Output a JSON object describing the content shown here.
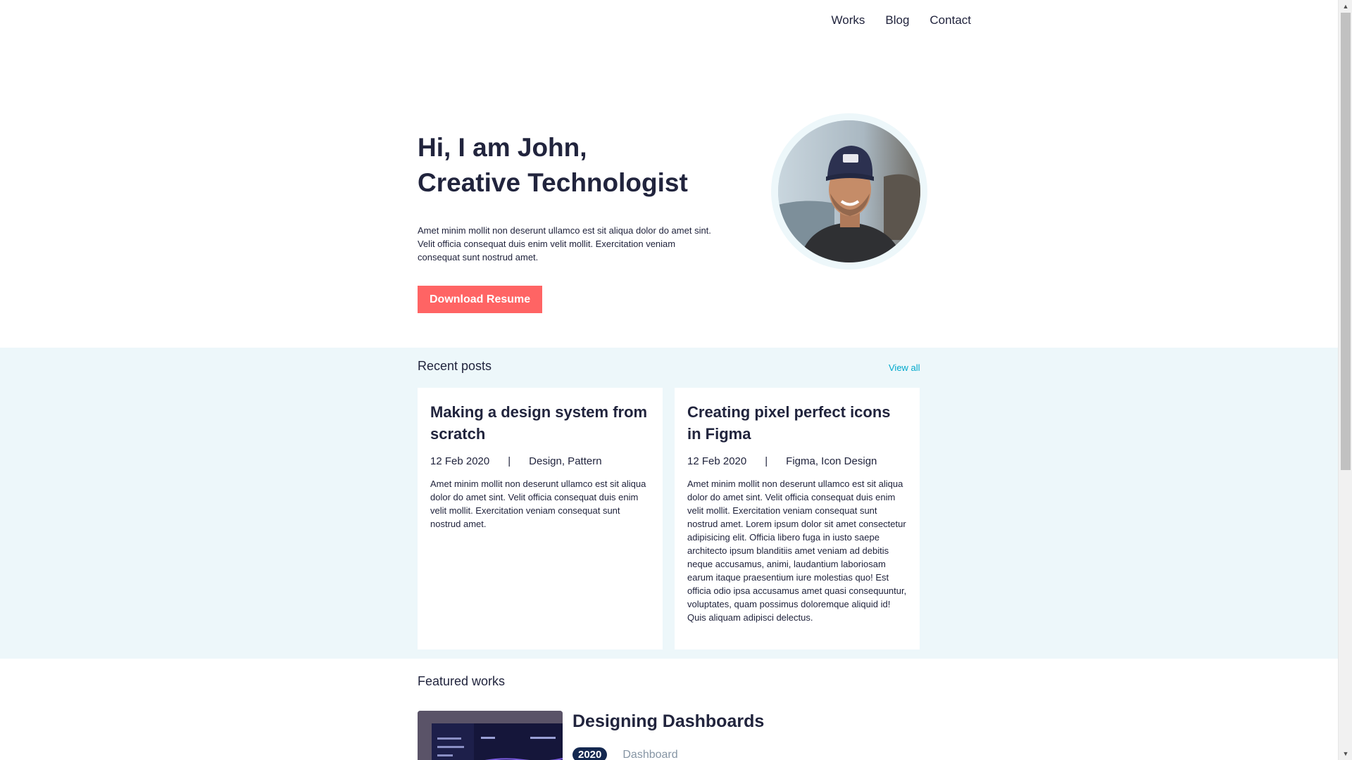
{
  "nav": {
    "items": [
      "Works",
      "Blog",
      "Contact"
    ]
  },
  "hero": {
    "title_line1": "Hi, I am John,",
    "title_line2": "Creative Technologist",
    "description": "Amet minim mollit non deserunt ullamco est sit aliqua dolor do amet sint. Velit officia consequat duis enim velit mollit. Exercitation veniam consequat sunt nostrud amet.",
    "button_label": "Download Resume"
  },
  "recent_posts": {
    "title": "Recent posts",
    "view_all": "View all",
    "posts": [
      {
        "title": "Making a design system from scratch",
        "date": "12 Feb 2020",
        "separator": "|",
        "tags": "Design, Pattern",
        "excerpt": "Amet minim mollit non deserunt ullamco est sit aliqua dolor do amet sint. Velit officia consequat duis enim velit mollit. Exercitation veniam consequat sunt nostrud amet."
      },
      {
        "title": "Creating pixel perfect icons in Figma",
        "date": "12 Feb 2020",
        "separator": "|",
        "tags": "Figma, Icon Design",
        "excerpt": "Amet minim mollit non deserunt ullamco est sit aliqua dolor do amet sint. Velit officia consequat duis enim velit mollit. Exercitation veniam consequat sunt nostrud amet. Lorem ipsum dolor sit amet consectetur adipisicing elit. Officia libero fuga in iusto saepe architecto ipsum blanditiis amet veniam ad debitis neque accusamus, animi, laudantium laboriosam earum itaque praesentium iure molestias quo! Est officia odio ipsa accusamus amet quasi consequuntur, voluptates, quam possimus doloremque aliquid id! Quis aliquam adipisci delectus."
      }
    ]
  },
  "featured_works": {
    "title": "Featured works",
    "works": [
      {
        "title": "Designing Dashboards",
        "year": "2020",
        "category": "Dashboard"
      }
    ]
  },
  "colors": {
    "accent": "#ff6464",
    "text": "#21243d",
    "section_bg": "#edf7fa",
    "link": "#00a8cc",
    "badge": "#142850"
  }
}
